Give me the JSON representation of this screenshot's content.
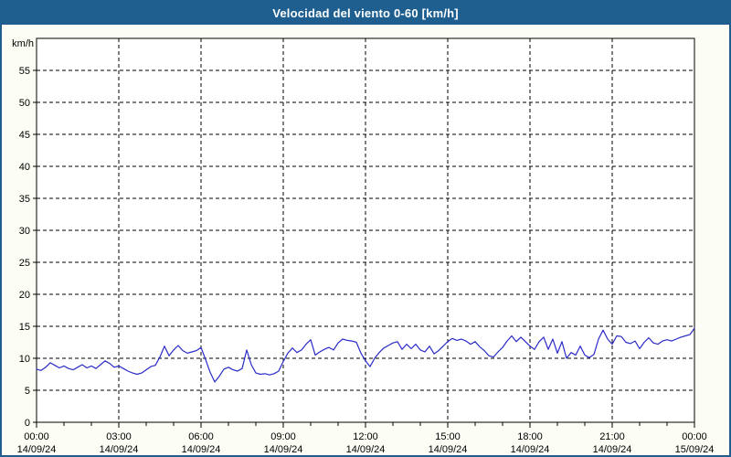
{
  "window": {
    "title": "Velocidad del viento 0-60 [km/h]"
  },
  "colors": {
    "title_bar": "#1e5f90",
    "border": "#1e5f90",
    "background": "#fcfdf5",
    "plot_background": "#ffffff",
    "grid": "#000000",
    "axis": "#000000",
    "line": "#2a2ac8",
    "title_text": "#ffffff",
    "tick_text": "#000000"
  },
  "chart_data": {
    "type": "line",
    "title": "Velocidad del viento 0-60 [km/h]",
    "ylabel": "km/h",
    "ylim": [
      0,
      60
    ],
    "ytick_step": 5,
    "ytick_labels": [
      "0",
      "5",
      "10",
      "15",
      "20",
      "25",
      "30",
      "35",
      "40",
      "45",
      "50",
      "55"
    ],
    "x_range_hours": [
      0,
      24
    ],
    "x_minor_tick_hours": 1,
    "x_major_ticks": [
      {
        "hour": 0,
        "time": "00:00",
        "date": "14/09/24"
      },
      {
        "hour": 3,
        "time": "03:00",
        "date": "14/09/24"
      },
      {
        "hour": 6,
        "time": "06:00",
        "date": "14/09/24"
      },
      {
        "hour": 9,
        "time": "09:00",
        "date": "14/09/24"
      },
      {
        "hour": 12,
        "time": "12:00",
        "date": "14/09/24"
      },
      {
        "hour": 15,
        "time": "15:00",
        "date": "14/09/24"
      },
      {
        "hour": 18,
        "time": "18:00",
        "date": "14/09/24"
      },
      {
        "hour": 21,
        "time": "21:00",
        "date": "14/09/24"
      },
      {
        "hour": 24,
        "time": "00:00",
        "date": "15/09/24"
      }
    ],
    "grid": "dashed",
    "legend": "none",
    "series": [
      {
        "name": "Velocidad del viento",
        "unit": "km/h",
        "start": "14/09/24 00:00",
        "interval_minutes": 10,
        "values": [
          8.3,
          8.1,
          8.6,
          9.3,
          8.9,
          8.5,
          8.8,
          8.4,
          8.2,
          8.6,
          9.0,
          8.5,
          8.8,
          8.4,
          9.0,
          9.6,
          9.2,
          8.6,
          8.8,
          8.4,
          8.0,
          7.7,
          7.5,
          7.7,
          8.2,
          8.7,
          8.9,
          10.2,
          11.9,
          10.4,
          11.3,
          12.0,
          11.2,
          10.8,
          11.0,
          11.2,
          11.7,
          9.8,
          7.8,
          6.3,
          7.2,
          8.3,
          8.6,
          8.2,
          8.0,
          8.4,
          11.3,
          9.0,
          7.7,
          7.5,
          7.6,
          7.4,
          7.6,
          8.0,
          9.5,
          10.8,
          11.6,
          10.9,
          11.3,
          12.2,
          12.9,
          10.5,
          11.0,
          11.4,
          11.7,
          11.3,
          12.4,
          13.0,
          12.8,
          12.7,
          12.5,
          10.8,
          9.6,
          8.7,
          10.0,
          10.9,
          11.6,
          12.0,
          12.4,
          12.6,
          11.4,
          12.2,
          11.5,
          12.2,
          11.3,
          11.0,
          11.9,
          10.7,
          11.2,
          11.9,
          12.6,
          13.1,
          12.8,
          13.0,
          12.7,
          12.2,
          12.6,
          11.8,
          11.2,
          10.4,
          10.2,
          11.0,
          11.7,
          12.7,
          13.5,
          12.6,
          13.3,
          12.6,
          11.9,
          11.4,
          12.6,
          13.3,
          11.4,
          13.0,
          10.8,
          12.6,
          10.0,
          10.9,
          10.5,
          11.9,
          10.5,
          10.1,
          10.6,
          13.0,
          14.4,
          13.0,
          12.2,
          13.5,
          13.4,
          12.5,
          12.3,
          12.7,
          11.5,
          12.5,
          13.2,
          12.4,
          12.2,
          12.7,
          12.9,
          12.7,
          13.0,
          13.3,
          13.5,
          13.7,
          14.7
        ]
      }
    ]
  }
}
